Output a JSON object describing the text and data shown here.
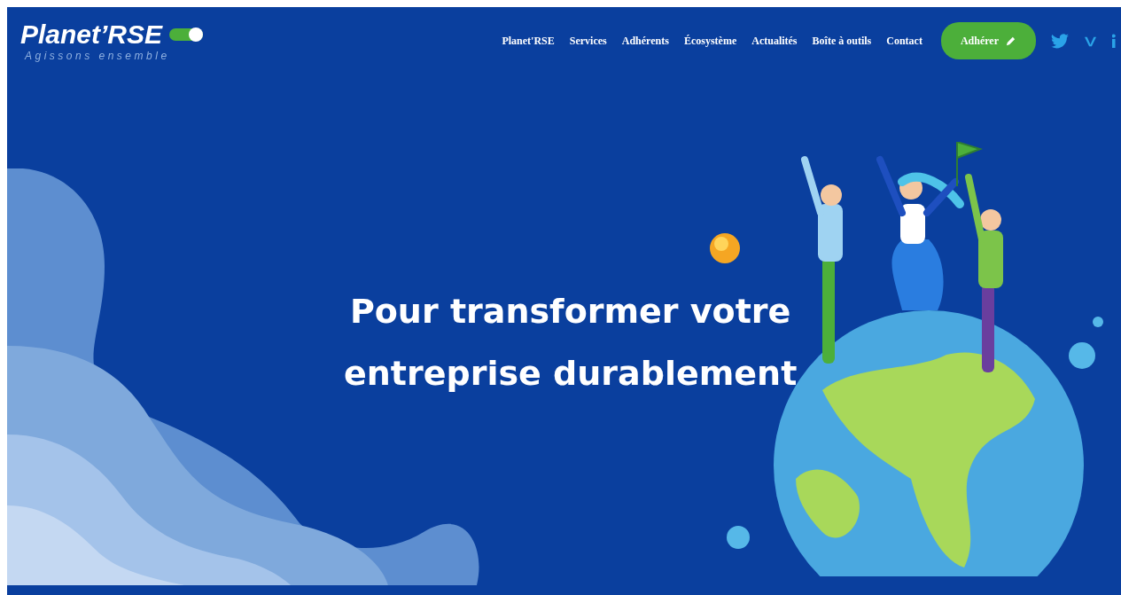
{
  "header": {
    "logo": {
      "name": "Planet’RSE",
      "tagline": "Agissons ensemble"
    },
    "nav": [
      {
        "label": "Planet'RSE"
      },
      {
        "label": "Services"
      },
      {
        "label": "Adhérents"
      },
      {
        "label": "Écosystème"
      },
      {
        "label": "Actualités"
      },
      {
        "label": "Boîte à outils"
      },
      {
        "label": "Contact"
      }
    ],
    "cta": {
      "label": "Adhérer"
    }
  },
  "hero": {
    "headline": [
      "Pour transformer votre",
      "entreprise durablement"
    ]
  }
}
